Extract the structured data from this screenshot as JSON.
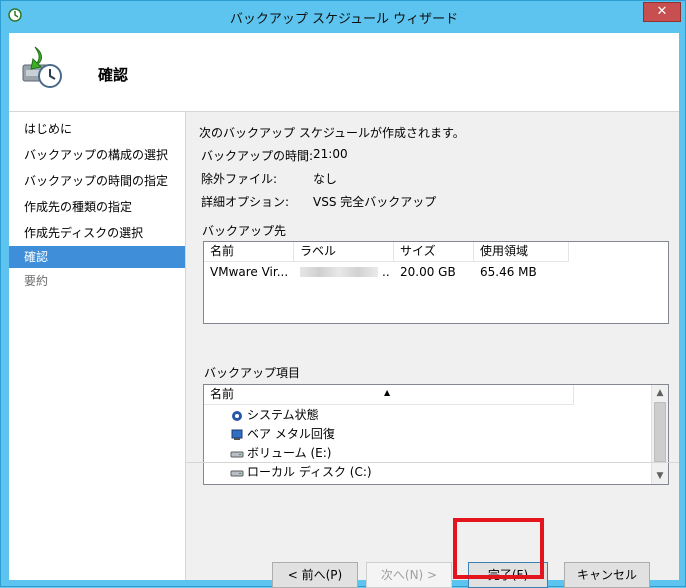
{
  "window": {
    "title": "バックアップ スケジュール ウィザード",
    "close_label": "✕"
  },
  "header": {
    "title": "確認",
    "icon": "backup-schedule-icon"
  },
  "sidebar": {
    "items": [
      {
        "label": "はじめに",
        "state": "normal"
      },
      {
        "label": "バックアップの構成の選択",
        "state": "normal"
      },
      {
        "label": "バックアップの時間の指定",
        "state": "normal"
      },
      {
        "label": "作成先の種類の指定",
        "state": "normal"
      },
      {
        "label": "作成先ディスクの選択",
        "state": "normal"
      },
      {
        "label": "確認",
        "state": "active"
      },
      {
        "label": "要約",
        "state": "disabled"
      }
    ]
  },
  "summary": {
    "intro": "次のバックアップ スケジュールが作成されます。",
    "rows": [
      {
        "label": "バックアップの時間:",
        "value": "21:00"
      },
      {
        "label": "除外ファイル:",
        "value": "なし"
      },
      {
        "label": "詳細オプション:",
        "value": "VSS 完全バックアップ"
      }
    ]
  },
  "destination": {
    "label": "バックアップ先",
    "columns": [
      "名前",
      "ラベル",
      "サイズ",
      "使用領域"
    ],
    "rows": [
      {
        "name": "VMware Vir...",
        "label_suffix": "..",
        "size": "20.00 GB",
        "used": "65.46 MB"
      }
    ]
  },
  "items": {
    "label": "バックアップ項目",
    "column": "名前",
    "sort_glyph": "▲",
    "entries": [
      {
        "label": "システム状態",
        "icon": "system-state-icon"
      },
      {
        "label": "ベア メタル回復",
        "icon": "bare-metal-icon"
      },
      {
        "label": "ボリューム (E:)",
        "icon": "drive-icon"
      },
      {
        "label": "ローカル ディスク (C:)",
        "icon": "drive-icon"
      }
    ]
  },
  "buttons": {
    "prev": "< 前へ(P)",
    "next": "次へ(N) >",
    "finish": "完了(F)",
    "cancel": "キャンセル"
  },
  "colors": {
    "accent": "#3e8ed9",
    "highlight": "#e4141e",
    "titlebar": "#5cc4ee"
  }
}
